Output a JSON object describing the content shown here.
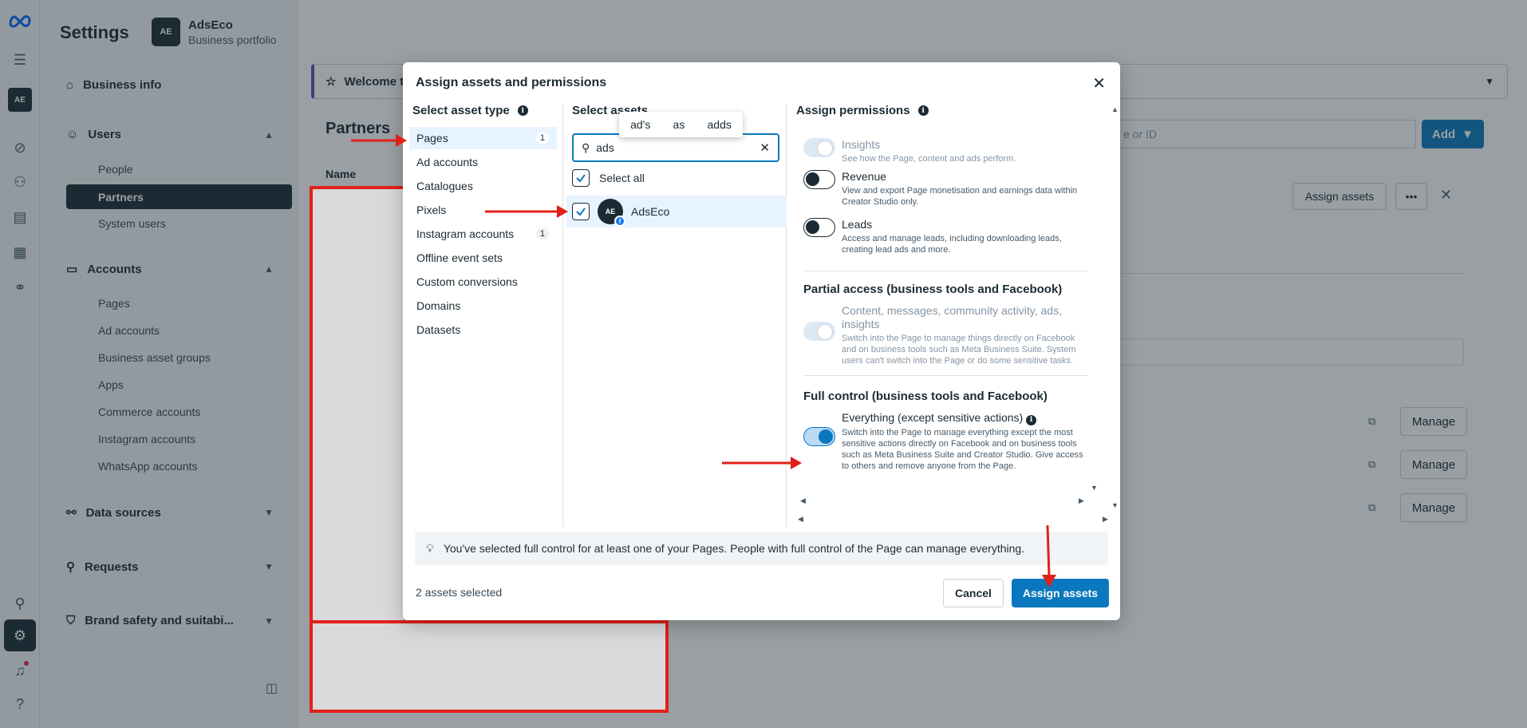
{
  "sidebar": {
    "title": "Settings",
    "portfolio_avatar": "AE",
    "portfolio_name": "AdsEco",
    "portfolio_sub": "Business portfolio",
    "business_info": "Business info",
    "users": "Users",
    "users_items": [
      "People",
      "Partners",
      "System users"
    ],
    "accounts": "Accounts",
    "accounts_items": [
      "Pages",
      "Ad accounts",
      "Business asset groups",
      "Apps",
      "Commerce accounts",
      "Instagram accounts",
      "WhatsApp accounts"
    ],
    "data_sources": "Data sources",
    "requests": "Requests",
    "brand_safety": "Brand safety and suitabi..."
  },
  "main": {
    "welcome": "Welcome t",
    "partners_heading": "Partners",
    "search_placeholder": "e or ID",
    "add_label": "Add",
    "name_column": "Name",
    "assign_assets": "Assign assets",
    "manage_label": "Manage"
  },
  "modal": {
    "title": "Assign assets and permissions",
    "col_asset_type": "Select asset type",
    "col_assets": "Select assets",
    "col_permissions": "Assign permissions",
    "asset_types": [
      {
        "label": "Pages",
        "count": "1"
      },
      {
        "label": "Ad accounts",
        "count": ""
      },
      {
        "label": "Catalogues",
        "count": ""
      },
      {
        "label": "Pixels",
        "count": ""
      },
      {
        "label": "Instagram accounts",
        "count": "1"
      },
      {
        "label": "Offline event sets",
        "count": ""
      },
      {
        "label": "Custom conversions",
        "count": ""
      },
      {
        "label": "Domains",
        "count": ""
      },
      {
        "label": "Datasets",
        "count": ""
      }
    ],
    "suggestions": [
      "ad's",
      "as",
      "adds"
    ],
    "search_value": "ads",
    "select_all": "Select all",
    "asset_name": "AdsEco",
    "asset_avatar": "AE",
    "permissions": {
      "insights_title": "Insights",
      "insights_desc": "See how the Page, content and ads perform.",
      "revenue_title": "Revenue",
      "revenue_desc": "View and export Page monetisation and earnings data within Creator Studio only.",
      "leads_title": "Leads",
      "leads_desc": "Access and manage leads, including downloading leads, creating lead ads and more.",
      "partial_heading": "Partial access (business tools and Facebook)",
      "partial_title": "Content, messages, community activity, ads, insights",
      "partial_desc": "Switch into the Page to manage things directly on Facebook and on business tools such as Meta Business Suite. System users can't switch into the Page or do some sensitive tasks.",
      "full_heading": "Full control (business tools and Facebook)",
      "full_title": "Everything (except sensitive actions)",
      "full_desc": "Switch into the Page to manage everything except the most sensitive actions directly on Facebook and on business tools such as Meta Business Suite and Creator Studio. Give access to others and remove anyone from the Page."
    },
    "notice": "You've selected full control for at least one of your Pages. People with full control of the Page can manage everything.",
    "selected_count": "2 assets selected",
    "cancel": "Cancel",
    "assign": "Assign assets"
  },
  "colors": {
    "accent": "#0a78be",
    "annotation": "#e1201a"
  }
}
